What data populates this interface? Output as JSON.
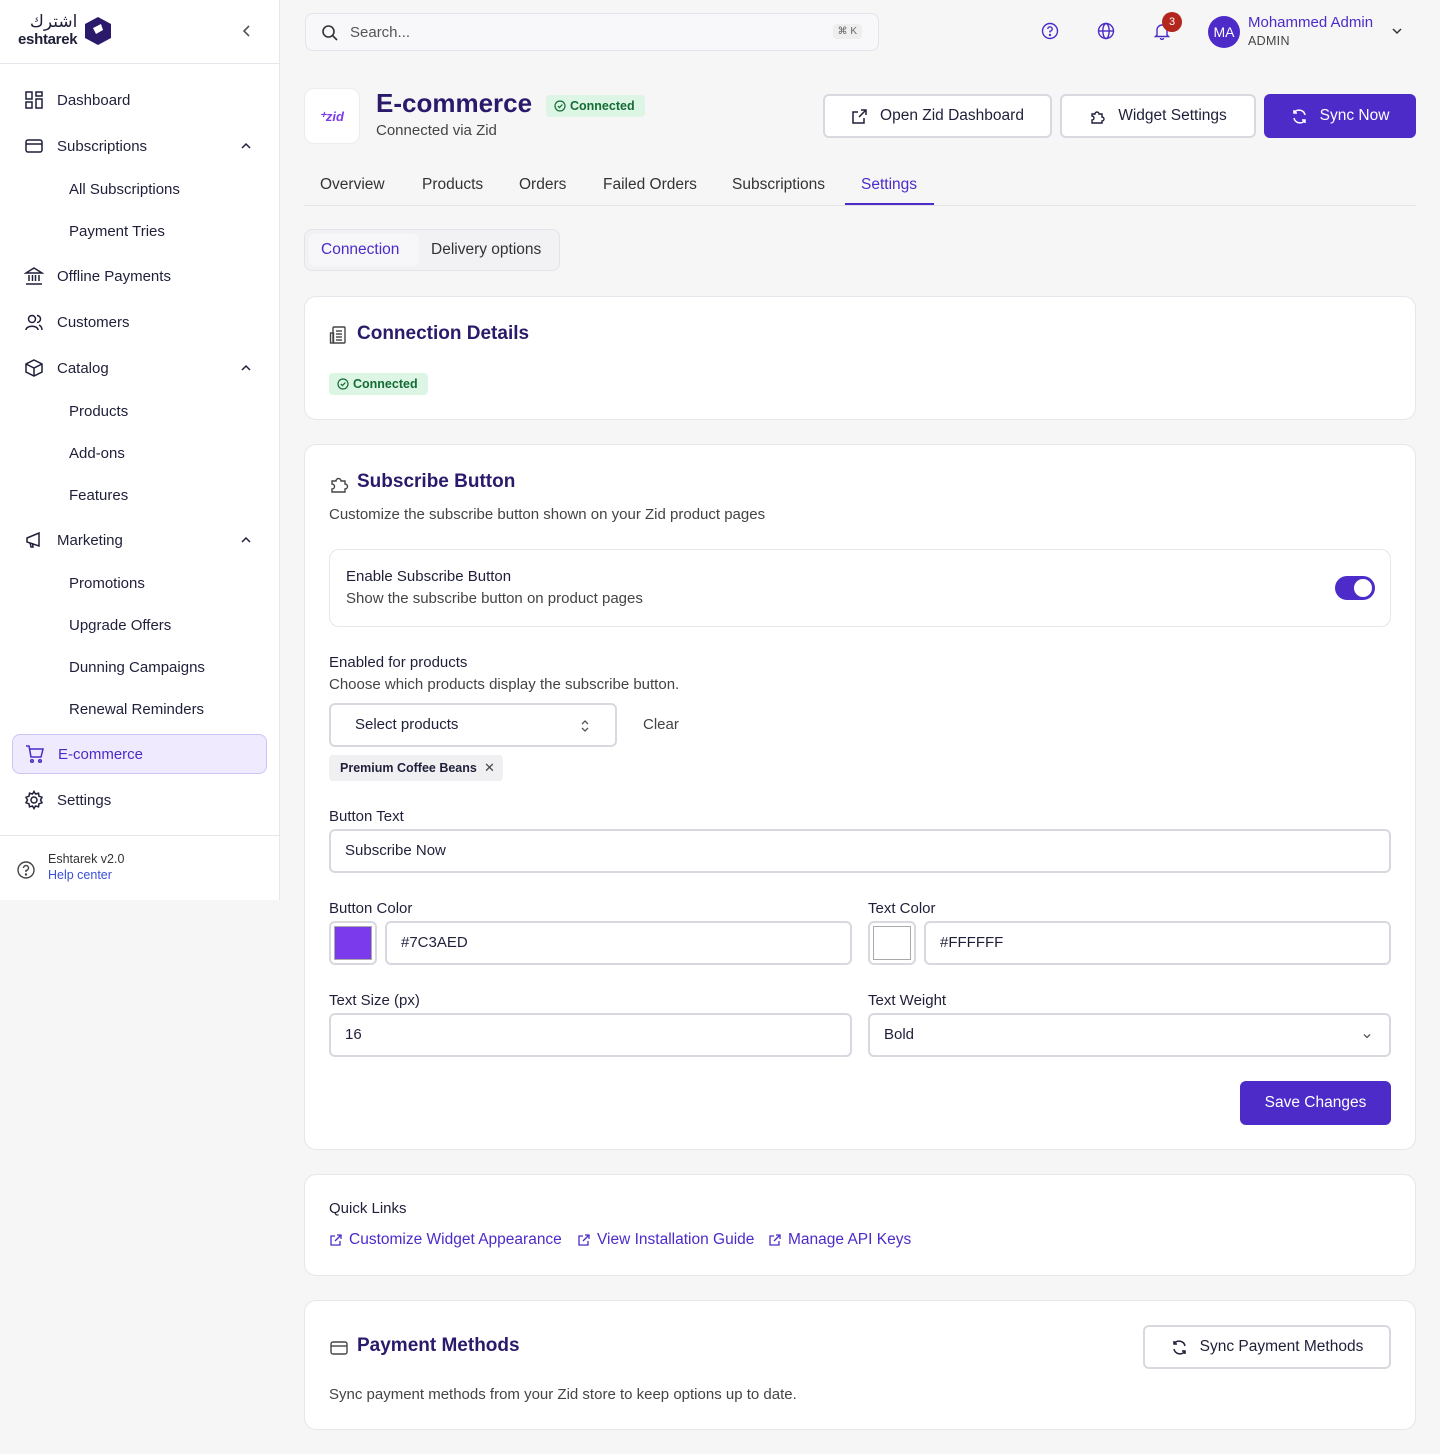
{
  "brand": {
    "arabic": "اشترك",
    "english": "eshtarek"
  },
  "sidebar": {
    "items": [
      {
        "label": "Dashboard"
      },
      {
        "label": "Subscriptions",
        "children": [
          "All Subscriptions",
          "Payment Tries"
        ]
      },
      {
        "label": "Offline Payments"
      },
      {
        "label": "Customers"
      },
      {
        "label": "Catalog",
        "children": [
          "Products",
          "Add-ons",
          "Features"
        ]
      },
      {
        "label": "Marketing",
        "children": [
          "Promotions",
          "Upgrade Offers",
          "Dunning Campaigns",
          "Renewal Reminders"
        ]
      },
      {
        "label": "E-commerce",
        "active": true
      },
      {
        "label": "Settings"
      }
    ],
    "footer": {
      "version": "Eshtarek v2.0",
      "help": "Help center"
    }
  },
  "topbar": {
    "search_placeholder": "Search...",
    "shortcut": "⌘ K",
    "notifications_count": "3",
    "user": {
      "initials": "MA",
      "name": "Mohammed Admin",
      "role": "ADMIN"
    }
  },
  "header": {
    "logo_text": "⁺zid",
    "title": "E-commerce",
    "status": "Connected",
    "subtitle": "Connected via Zid",
    "buttons": {
      "open_dashboard": "Open Zid Dashboard",
      "widget_settings": "Widget Settings",
      "sync_now": "Sync Now"
    }
  },
  "tabs": [
    "Overview",
    "Products",
    "Orders",
    "Failed Orders",
    "Subscriptions",
    "Settings"
  ],
  "active_tab": "Settings",
  "subtabs": [
    "Connection",
    "Delivery options"
  ],
  "connection": {
    "title": "Connection Details",
    "status": "Connected"
  },
  "subscribe_button": {
    "title": "Subscribe Button",
    "description": "Customize the subscribe button shown on your Zid product pages",
    "enable": {
      "label": "Enable Subscribe Button",
      "description": "Show the subscribe button on product pages",
      "enabled": true
    },
    "products": {
      "label": "Enabled for products",
      "description": "Choose which products display the subscribe button.",
      "placeholder": "Select products",
      "clear": "Clear",
      "selected": [
        "Premium Coffee Beans"
      ]
    },
    "button_text": {
      "label": "Button Text",
      "value": "Subscribe Now"
    },
    "button_color": {
      "label": "Button Color",
      "value": "#7C3AED"
    },
    "text_color": {
      "label": "Text Color",
      "value": "#FFFFFF"
    },
    "text_size": {
      "label": "Text Size (px)",
      "value": "16"
    },
    "text_weight": {
      "label": "Text Weight",
      "value": "Bold"
    },
    "save": "Save Changes"
  },
  "quick_links": {
    "title": "Quick Links",
    "links": [
      "Customize Widget Appearance",
      "View Installation Guide",
      "Manage API Keys"
    ]
  },
  "payment_methods": {
    "title": "Payment Methods",
    "button": "Sync Payment Methods",
    "description": "Sync payment methods from your Zid store to keep options up to date."
  },
  "colors": {
    "primary": "#4C2BC9",
    "accent": "#7C3AED",
    "success_bg": "#DCF5E4",
    "badge": "#B3261E"
  }
}
